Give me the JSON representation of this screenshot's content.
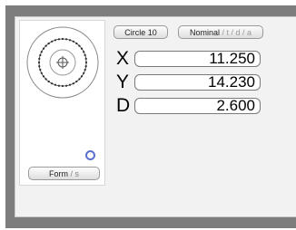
{
  "feature": {
    "name_button": "Circle 10",
    "mode_button_main": "Nominal",
    "mode_button_sub": " / t / d / a"
  },
  "form_button": {
    "main": "Form",
    "sub": " / s"
  },
  "measurements": [
    {
      "axis": "X",
      "value": "11.250"
    },
    {
      "axis": "Y",
      "value": "14.230"
    },
    {
      "axis": "D",
      "value": "2.600"
    }
  ],
  "icons": {
    "gauge": "circle-feature-icon",
    "status": "ring-icon"
  },
  "colors": {
    "window_frame": "#7d7d7d",
    "panel": "#f2f2f2",
    "status_ring": "#5a6fcf"
  }
}
